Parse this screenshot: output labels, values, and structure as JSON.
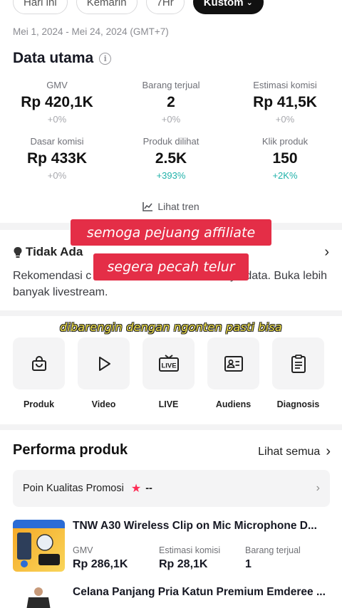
{
  "date_tabs": [
    {
      "label": "Hari ini",
      "active": false
    },
    {
      "label": "Kemarin",
      "active": false
    },
    {
      "label": "7Hr",
      "active": false
    },
    {
      "label": "Kustom",
      "active": true
    }
  ],
  "date_range": "Mei 1, 2024 - Mei 24, 2024 (GMT+7)",
  "data_utama": {
    "title": "Data utama",
    "metrics": [
      {
        "label": "GMV",
        "value": "Rp 420,1K",
        "change": "+0%"
      },
      {
        "label": "Barang terjual",
        "value": "2",
        "change": "+0%"
      },
      {
        "label": "Estimasi komisi",
        "value": "Rp 41,5K",
        "change": "+0%"
      },
      {
        "label": "Dasar komisi",
        "value": "Rp 433K",
        "change": "+0%"
      },
      {
        "label": "Produk dilihat",
        "value": "2.5K",
        "change": "+393%"
      },
      {
        "label": "Klik produk",
        "value": "150",
        "change": "+2K%"
      }
    ],
    "trend_link": "Lihat tren"
  },
  "recommendation": {
    "title": "Tidak Ada",
    "text_before": "Rekomendasi c",
    "text_after": "ena minimnya data. Buka lebih banyak livestream."
  },
  "overlays": {
    "line1": "semoga pejuang affiliate",
    "line2": "segera pecah telur",
    "caption": "dibarengin dengan ngonten pasti bisa"
  },
  "tools": [
    {
      "label": "Produk",
      "icon": "bag-icon"
    },
    {
      "label": "Video",
      "icon": "play-icon"
    },
    {
      "label": "LIVE",
      "icon": "live-tv-icon"
    },
    {
      "label": "Audiens",
      "icon": "id-card-icon"
    },
    {
      "label": "Diagnosis",
      "icon": "clipboard-icon"
    }
  ],
  "performa": {
    "title": "Performa produk",
    "see_all": "Lihat semua",
    "promo_label": "Poin Kualitas Promosi",
    "promo_value": "--",
    "products": [
      {
        "name": "TNW A30 Wireless Clip on Mic Microphone D...",
        "stats": [
          {
            "label": "GMV",
            "value": "Rp 286,1K"
          },
          {
            "label": "Estimasi komisi",
            "value": "Rp 28,1K"
          },
          {
            "label": "Barang terjual",
            "value": "1"
          }
        ]
      },
      {
        "name": "Celana Panjang Pria Katun Premium Emderee ...",
        "stats": []
      }
    ]
  },
  "colors": {
    "accent_red": "#fe2c55",
    "positive": "#20b2aa",
    "overlay_red": "#e42e47",
    "caption_yellow": "#f5e54a"
  }
}
